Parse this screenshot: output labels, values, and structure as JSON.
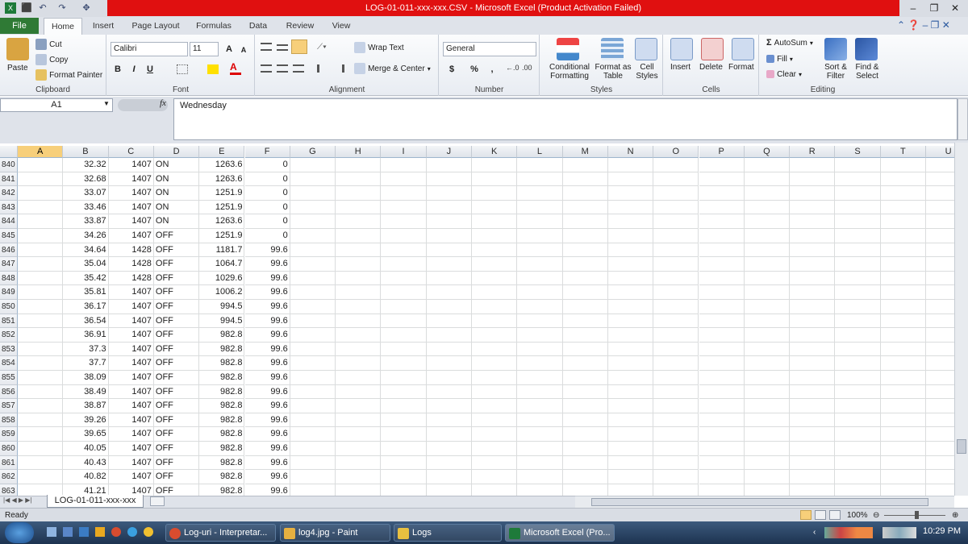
{
  "window": {
    "title": "LOG-01-011-xxx-xxx.CSV - Microsoft Excel (Product Activation Failed)",
    "minimize": "–",
    "restore": "❐",
    "close": "✕"
  },
  "quick_access": [
    "⬛",
    "↶",
    "↷",
    "✥"
  ],
  "tabs": {
    "file": "File",
    "items": [
      "Home",
      "Insert",
      "Page Layout",
      "Formulas",
      "Data",
      "Review",
      "View"
    ]
  },
  "ribbon": {
    "clipboard": {
      "paste": "Paste",
      "cut": "Cut",
      "copy": "Copy",
      "format_painter": "Format Painter",
      "label": "Clipboard"
    },
    "font": {
      "name": "Calibri",
      "size": "11",
      "bold": "B",
      "italic": "I",
      "underline": "U",
      "label": "Font"
    },
    "alignment": {
      "wrap": "Wrap Text",
      "merge": "Merge & Center",
      "label": "Alignment"
    },
    "number": {
      "format": "General",
      "label": "Number",
      "currency": "$",
      "percent": "%",
      "comma": ","
    },
    "styles": {
      "conditional": "Conditional Formatting",
      "format_table": "Format as Table",
      "cell_styles": "Cell Styles",
      "label": "Styles"
    },
    "cells": {
      "insert": "Insert",
      "delete": "Delete",
      "format": "Format",
      "label": "Cells"
    },
    "editing": {
      "autosum": "AutoSum",
      "fill": "Fill",
      "clear": "Clear",
      "sort": "Sort & Filter",
      "find": "Find & Select",
      "label": "Editing"
    }
  },
  "formula_bar": {
    "name_box": "A1",
    "fx": "fx",
    "value": "Wednesday"
  },
  "columns": [
    "A",
    "B",
    "C",
    "D",
    "E",
    "F",
    "G",
    "H",
    "I",
    "J",
    "K",
    "L",
    "M",
    "N",
    "O",
    "P",
    "Q",
    "R",
    "S",
    "T",
    "U"
  ],
  "rows": [
    {
      "n": "840",
      "B": "32.32",
      "C": "1407",
      "D": "ON",
      "E": "1263.6",
      "F": "0"
    },
    {
      "n": "841",
      "B": "32.68",
      "C": "1407",
      "D": "ON",
      "E": "1263.6",
      "F": "0"
    },
    {
      "n": "842",
      "B": "33.07",
      "C": "1407",
      "D": "ON",
      "E": "1251.9",
      "F": "0"
    },
    {
      "n": "843",
      "B": "33.46",
      "C": "1407",
      "D": "ON",
      "E": "1251.9",
      "F": "0"
    },
    {
      "n": "844",
      "B": "33.87",
      "C": "1407",
      "D": "ON",
      "E": "1263.6",
      "F": "0"
    },
    {
      "n": "845",
      "B": "34.26",
      "C": "1407",
      "D": "OFF",
      "E": "1251.9",
      "F": "0"
    },
    {
      "n": "846",
      "B": "34.64",
      "C": "1428",
      "D": "OFF",
      "E": "1181.7",
      "F": "99.6"
    },
    {
      "n": "847",
      "B": "35.04",
      "C": "1428",
      "D": "OFF",
      "E": "1064.7",
      "F": "99.6"
    },
    {
      "n": "848",
      "B": "35.42",
      "C": "1428",
      "D": "OFF",
      "E": "1029.6",
      "F": "99.6"
    },
    {
      "n": "849",
      "B": "35.81",
      "C": "1407",
      "D": "OFF",
      "E": "1006.2",
      "F": "99.6"
    },
    {
      "n": "850",
      "B": "36.17",
      "C": "1407",
      "D": "OFF",
      "E": "994.5",
      "F": "99.6"
    },
    {
      "n": "851",
      "B": "36.54",
      "C": "1407",
      "D": "OFF",
      "E": "994.5",
      "F": "99.6"
    },
    {
      "n": "852",
      "B": "36.91",
      "C": "1407",
      "D": "OFF",
      "E": "982.8",
      "F": "99.6"
    },
    {
      "n": "853",
      "B": "37.3",
      "C": "1407",
      "D": "OFF",
      "E": "982.8",
      "F": "99.6"
    },
    {
      "n": "854",
      "B": "37.7",
      "C": "1407",
      "D": "OFF",
      "E": "982.8",
      "F": "99.6"
    },
    {
      "n": "855",
      "B": "38.09",
      "C": "1407",
      "D": "OFF",
      "E": "982.8",
      "F": "99.6"
    },
    {
      "n": "856",
      "B": "38.49",
      "C": "1407",
      "D": "OFF",
      "E": "982.8",
      "F": "99.6"
    },
    {
      "n": "857",
      "B": "38.87",
      "C": "1407",
      "D": "OFF",
      "E": "982.8",
      "F": "99.6"
    },
    {
      "n": "858",
      "B": "39.26",
      "C": "1407",
      "D": "OFF",
      "E": "982.8",
      "F": "99.6"
    },
    {
      "n": "859",
      "B": "39.65",
      "C": "1407",
      "D": "OFF",
      "E": "982.8",
      "F": "99.6"
    },
    {
      "n": "860",
      "B": "40.05",
      "C": "1407",
      "D": "OFF",
      "E": "982.8",
      "F": "99.6"
    },
    {
      "n": "861",
      "B": "40.43",
      "C": "1407",
      "D": "OFF",
      "E": "982.8",
      "F": "99.6"
    },
    {
      "n": "862",
      "B": "40.82",
      "C": "1407",
      "D": "OFF",
      "E": "982.8",
      "F": "99.6"
    },
    {
      "n": "863",
      "B": "41.21",
      "C": "1407",
      "D": "OFF",
      "E": "982.8",
      "F": "99.6"
    }
  ],
  "sheet_tab": "LOG-01-011-xxx-xxx",
  "status": {
    "state": "Ready",
    "zoom": "100%"
  },
  "taskbar": {
    "items": [
      "Log-uri - Interpretar...",
      "log4.jpg - Paint",
      "Logs",
      "Microsoft Excel (Pro..."
    ],
    "clock": "10:29 PM"
  },
  "colors": {
    "title_red": "#e01010",
    "file_green": "#2f7a35",
    "selected_header": "#f7cf7a"
  }
}
